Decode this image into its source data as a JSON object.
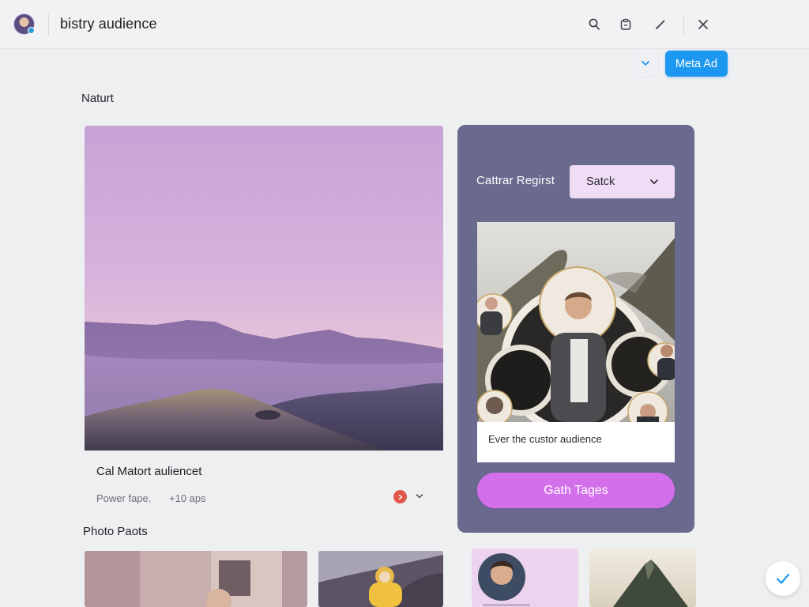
{
  "header": {
    "title": "bistry audience",
    "icons": [
      "search-icon",
      "clipboard-icon",
      "edit-icon",
      "close-icon"
    ]
  },
  "toolbar": {
    "meta_button_label": "Meta Ad",
    "expand_icon": "chevron-down-icon"
  },
  "main": {
    "section_title": "Naturt",
    "hero": {
      "caption": "Cal Matort auliencet",
      "meta_left": "Power fape.",
      "meta_right": "+10 aps"
    },
    "panel": {
      "label": "Cattrar Regirst",
      "select_value": "Satck",
      "caption": "Ever the custor audience",
      "cta_label": "Gath Tages"
    }
  },
  "photos": {
    "section_title": "Photo Paots",
    "thumbnail_count": 4
  },
  "colors": {
    "accent_blue": "#1d98f0",
    "panel_purple": "#6a6a8e",
    "cta_pink": "#d46fec",
    "select_bg": "#f1dcf6",
    "status_red": "#e2574c"
  }
}
